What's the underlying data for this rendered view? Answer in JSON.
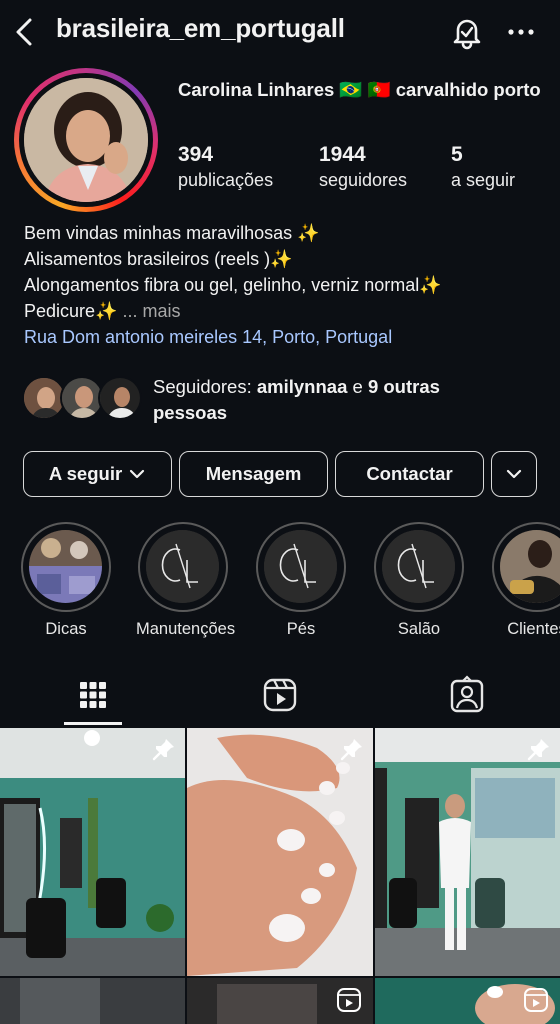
{
  "header": {
    "username": "brasileira_em_portugall",
    "back_icon": "chevron-left-icon",
    "bell_icon": "bell-icon",
    "more_icon": "more-horizontal-icon"
  },
  "profile": {
    "name_line": "Carolina Linhares 🇧🇷 🇵🇹 carvalhido porto",
    "stats": [
      {
        "num": "394",
        "label": "publicações"
      },
      {
        "num": "1944",
        "label": "seguidores"
      },
      {
        "num": "5",
        "label": "a seguir"
      }
    ],
    "bio": [
      "Bem vindas minhas maravilhosas ✨",
      "Alisamentos brasileiros (reels )✨",
      "Alongamentos fibra ou gel, gelinho, verniz normal✨",
      "Pedicure✨"
    ],
    "bio_more": "... mais",
    "location": "Rua Dom antonio meireles 14, Porto, Portugal"
  },
  "followers": {
    "prefix": "Seguidores: ",
    "name": "amilynnaa",
    "join": " e ",
    "others": "9 outras pessoas"
  },
  "buttons": {
    "following": "A seguir",
    "message": "Mensagem",
    "contact": "Contactar"
  },
  "highlights": [
    {
      "label": "Dicas"
    },
    {
      "label": "Manutenções"
    },
    {
      "label": "Pés"
    },
    {
      "label": "Salão"
    },
    {
      "label": "Clientes"
    }
  ],
  "tabs": {
    "icons": [
      "grid-icon",
      "reels-icon",
      "tagged-icon"
    ],
    "active": "grid-icon"
  },
  "colors": {
    "background": "#0c0f14",
    "location_link": "#a9c8ff",
    "muted": "#a8a8a8"
  }
}
